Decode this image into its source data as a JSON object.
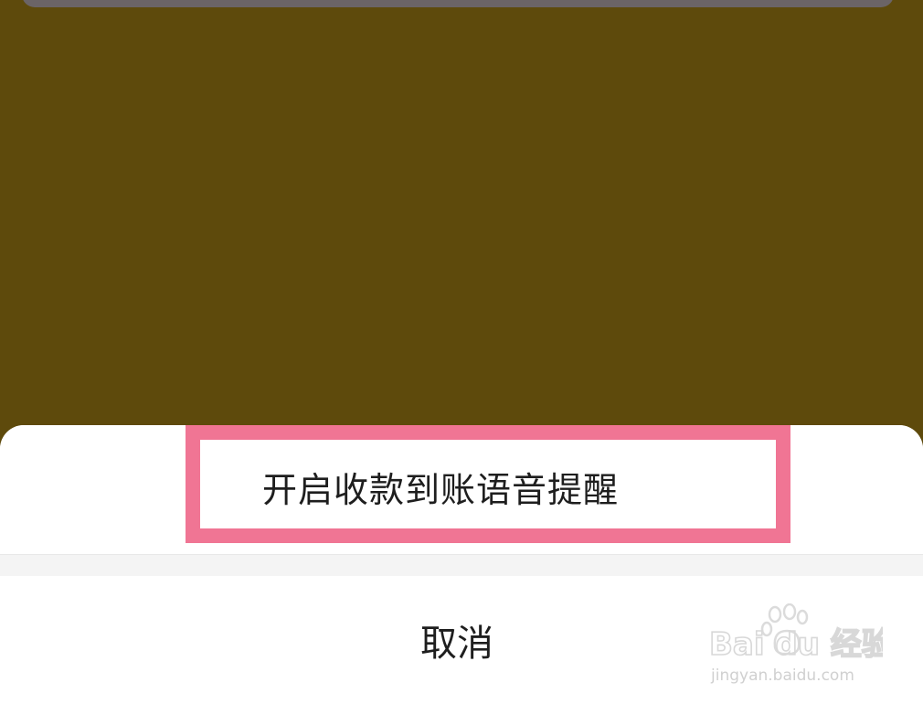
{
  "action_sheet": {
    "option_label": "开启收款到账语音提醒",
    "cancel_label": "取消"
  },
  "watermark": {
    "brand": "Bai du 经验",
    "url": "jingyan.baidu.com"
  },
  "colors": {
    "backdrop": "#5e4a0c",
    "highlight": "#f07594",
    "sheet": "#ffffff",
    "separator": "#f4f4f4"
  }
}
